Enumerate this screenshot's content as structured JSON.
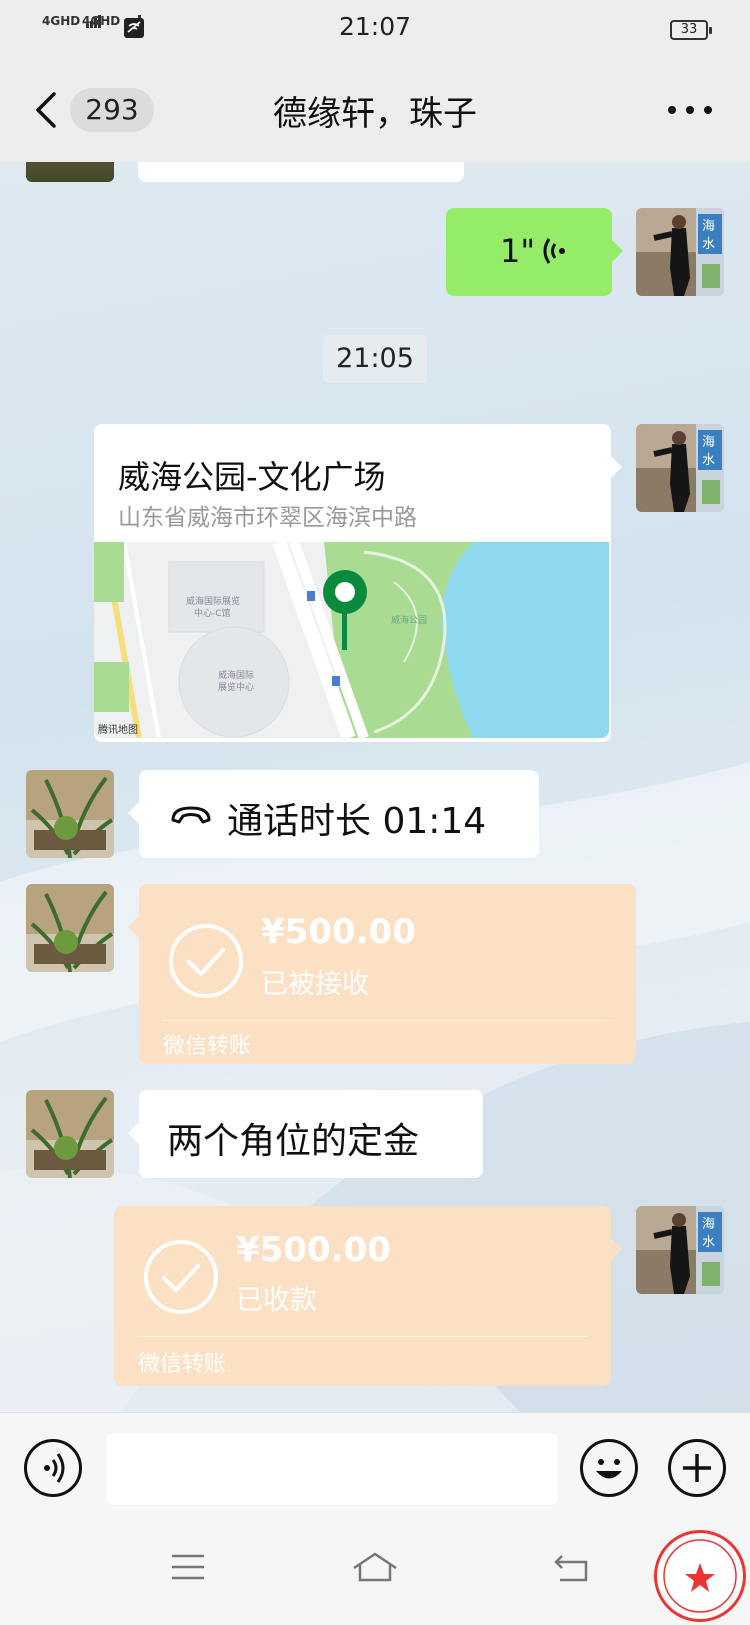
{
  "status_bar": {
    "time": "21:07",
    "signal_1": "4GHD",
    "signal_2": "4GHD",
    "battery": "33"
  },
  "header": {
    "unread_count": "293",
    "title": "德缘轩，珠子"
  },
  "messages": {
    "voice": {
      "text": "1\""
    },
    "timestamp": "21:05",
    "location": {
      "name": "威海公园-文化广场",
      "address": "山东省威海市环翠区海滨中路",
      "map_credit": "腾讯地图",
      "map_labels": [
        "威海国际展览中心-C馆",
        "威海国际展览中心",
        "威海公园"
      ]
    },
    "call": {
      "text": "通话时长 01:14"
    },
    "transfer_1": {
      "amount": "¥500.00",
      "status": "已被接收",
      "footer": "微信转账"
    },
    "text_1": {
      "text": "两个角位的定金"
    },
    "transfer_2": {
      "amount": "¥500.00",
      "status": "已收款",
      "footer": "微信转账"
    }
  },
  "colors": {
    "green_bubble": "#95ec69",
    "transfer_bg": "#fbe0c4",
    "map_pin": "#0a8a3c"
  },
  "icons": [
    "back-icon",
    "more-icon",
    "voice-wave-icon",
    "map-pin-icon",
    "phone-hangup-icon",
    "check-circle-icon",
    "voice-input-icon",
    "emoji-icon",
    "plus-icon",
    "menu-icon",
    "home-icon",
    "back-nav-icon"
  ]
}
